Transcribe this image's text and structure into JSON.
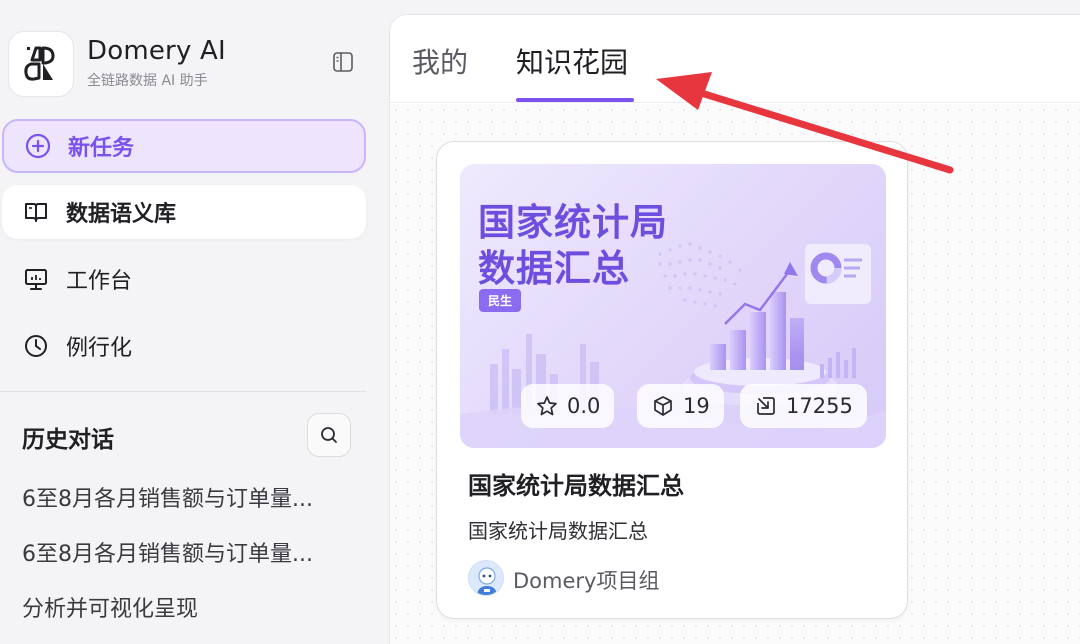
{
  "brand": {
    "name": "Domery AI",
    "subtitle": "全链路数据 AI 助手"
  },
  "sidebar": {
    "nav": [
      {
        "label": "新任务",
        "icon": "plus-circle-icon"
      },
      {
        "label": "数据语义库",
        "icon": "book-icon"
      },
      {
        "label": "工作台",
        "icon": "presentation-board-icon"
      },
      {
        "label": "例行化",
        "icon": "clock-icon"
      }
    ],
    "history_title": "历史对话",
    "history": [
      "6至8月各月销售额与订单量...",
      "6至8月各月销售额与订单量...",
      "分析并可视化呈现"
    ]
  },
  "tabs": [
    {
      "label": "我的",
      "active": false
    },
    {
      "label": "知识花园",
      "active": true
    }
  ],
  "card": {
    "cover_title_line1": "国家统计局",
    "cover_title_line2": "数据汇总",
    "cover_tag": "民生",
    "stats": {
      "rating": "0.0",
      "count": "19",
      "views": "17255"
    },
    "title": "国家统计局数据汇总",
    "description": "国家统计局数据汇总",
    "author": "Domery项目组"
  },
  "colors": {
    "accent": "#7b52ee",
    "accent_light": "#ece5fd",
    "annotation": "#e8363f"
  }
}
